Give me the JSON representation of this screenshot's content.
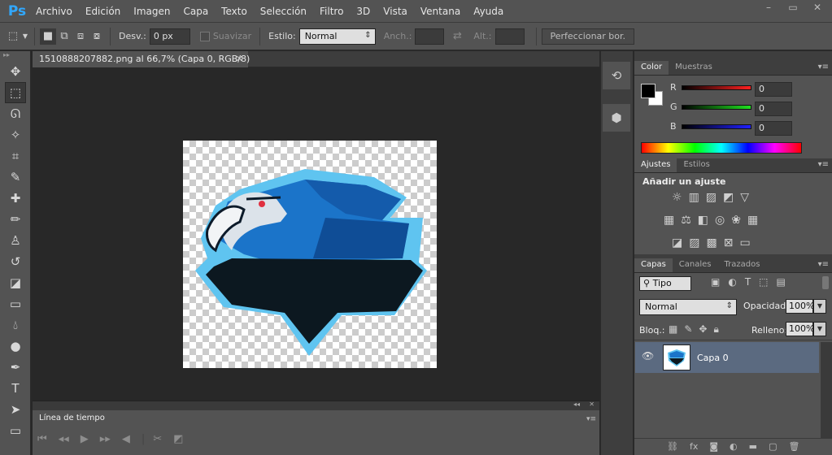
{
  "app": {
    "logo": "Ps"
  },
  "menu": [
    "Archivo",
    "Edición",
    "Imagen",
    "Capa",
    "Texto",
    "Selección",
    "Filtro",
    "3D",
    "Vista",
    "Ventana",
    "Ayuda"
  ],
  "window_controls": {
    "minimize": "–",
    "restore": "▭",
    "close": "✕"
  },
  "options": {
    "feather_label": "Desv.:",
    "feather_value": "0 px",
    "antialias_label": "Suavizar",
    "style_label": "Estilo:",
    "style_value": "Normal",
    "width_label": "Anch.:",
    "height_label": "Alt.:",
    "refine_button": "Perfeccionar bor."
  },
  "document_tab": {
    "title": "1510888207882.png al 66,7% (Capa 0, RGB/8)",
    "close": "✕"
  },
  "tools": [
    "move-icon",
    "marquee-icon",
    "lasso-icon",
    "magic-wand-icon",
    "crop-icon",
    "eyedropper-icon",
    "healing-brush-icon",
    "brush-icon",
    "clone-stamp-icon",
    "history-brush-icon",
    "eraser-icon",
    "gradient-icon",
    "blur-icon",
    "dodge-icon",
    "pen-icon",
    "type-icon",
    "path-select-icon",
    "rectangle-icon"
  ],
  "timeline": {
    "tab": "Línea de tiempo"
  },
  "color_panel": {
    "tabs": [
      "Color",
      "Muestras"
    ],
    "channels": [
      {
        "name": "R",
        "value": "0",
        "color": "#ff2020"
      },
      {
        "name": "G",
        "value": "0",
        "color": "#20e020"
      },
      {
        "name": "B",
        "value": "0",
        "color": "#2020ff"
      }
    ]
  },
  "adjustments_panel": {
    "tabs": [
      "Ajustes",
      "Estilos"
    ],
    "heading": "Añadir un ajuste"
  },
  "layers_panel": {
    "tabs": [
      "Capas",
      "Canales",
      "Trazados"
    ],
    "filter_value": "Tipo",
    "blend_mode": "Normal",
    "opacity_label": "Opacidad:",
    "opacity_value": "100%",
    "lock_label": "Bloq.:",
    "fill_label": "Relleno:",
    "fill_value": "100%",
    "layers": [
      {
        "name": "Capa 0",
        "visible": true
      }
    ]
  },
  "colors": {
    "accent": "#31a8ff",
    "selected_layer": "#5b6a80",
    "panel": "#535353"
  }
}
